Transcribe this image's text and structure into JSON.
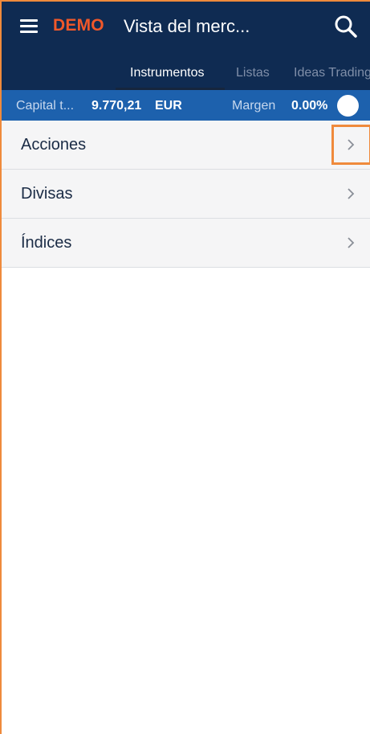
{
  "header": {
    "demo_label": "DEMO",
    "title": "Vista del merc...",
    "menu_icon": "hamburger-menu-icon",
    "search_icon": "search-icon"
  },
  "tabs": [
    {
      "label": "Instrumentos",
      "active": true
    },
    {
      "label": "Listas",
      "active": false
    },
    {
      "label": "Ideas Trading",
      "active": false
    }
  ],
  "account_bar": {
    "capital_label": "Capital t...",
    "capital_value": "9.770,21",
    "currency": "EUR",
    "margin_label": "Margen",
    "margin_value": "0.00%"
  },
  "categories": [
    {
      "label": "Acciones",
      "icon": "chevron-right-icon"
    },
    {
      "label": "Divisas",
      "icon": "chevron-right-icon"
    },
    {
      "label": "Índices",
      "icon": "chevron-right-icon"
    }
  ],
  "colors": {
    "app_bar": "#0f2b52",
    "account_bar": "#1d61ad",
    "demo_accent": "#f0582a",
    "highlight": "#ef8a3c"
  }
}
